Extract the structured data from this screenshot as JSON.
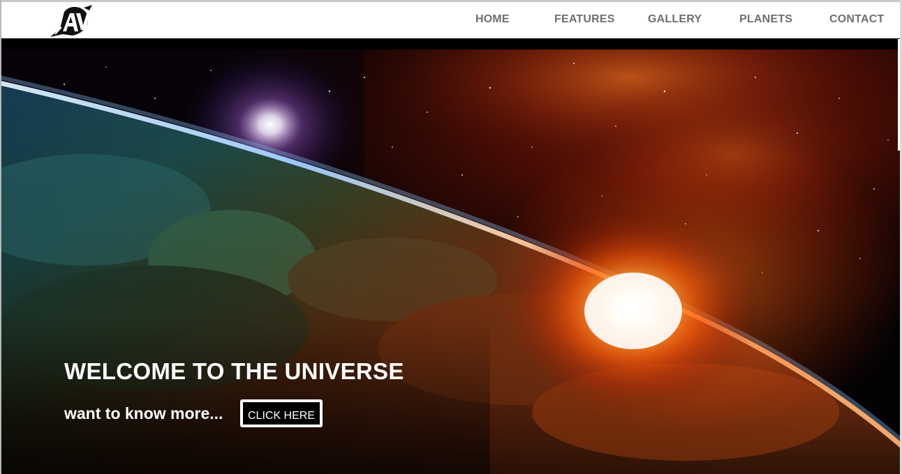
{
  "nav": {
    "logo_text": "AV",
    "items": [
      {
        "label": "HOME"
      },
      {
        "label": "FEATURES"
      },
      {
        "label": "GALLERY"
      },
      {
        "label": "PLANETS"
      },
      {
        "label": "CONTACT"
      }
    ],
    "text_color": "#6e6e6e"
  },
  "hero": {
    "title": "WELCOME TO THE UNIVERSE",
    "subtitle": "want to know more...",
    "button_label": "CLICK HERE",
    "background_description_icon": "space-planet-sunrise-image",
    "colors": {
      "text": "#ffffff",
      "button_bg": "#000000",
      "button_border": "#ffffff",
      "sun_glow": "#ff6a00"
    }
  }
}
